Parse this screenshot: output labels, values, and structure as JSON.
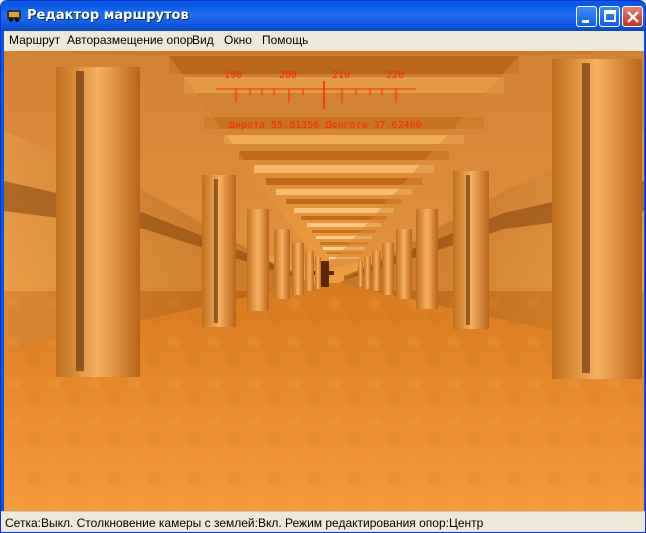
{
  "window": {
    "title": "Редактор маршрутов"
  },
  "menu": [
    {
      "label": "Маршрут"
    },
    {
      "label": "Авторазмещение опор"
    },
    {
      "label": "Вид"
    },
    {
      "label": "Окно"
    },
    {
      "label": "Помощь"
    }
  ],
  "hud": {
    "compass_ticks": [
      "190",
      "200",
      "210",
      "220"
    ],
    "coords_text": "Широта 55.81356 Долгота 37.62400"
  },
  "status": {
    "text": "Сетка:Выкл. Столкновение камеры с землей:Вкл. Режим редактирования опор:Центр"
  },
  "colors": {
    "hud": "#ff2a00",
    "titlebar": "#0458e3",
    "scene": "#e38a2a"
  },
  "icons": [
    "app-icon",
    "minimize-icon",
    "maximize-icon",
    "close-icon"
  ]
}
